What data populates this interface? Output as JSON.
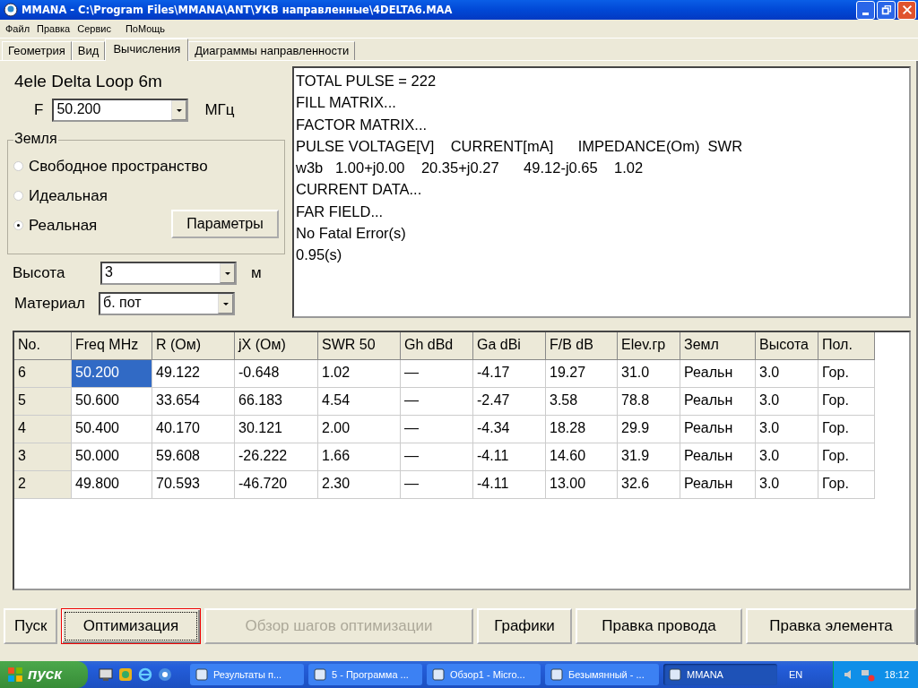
{
  "window": {
    "title": "MMANA - C:\\Program Files\\MMANA\\ANT\\УКВ направленные\\4DELTA6.MAA"
  },
  "menu": [
    "Файл",
    "Правка",
    "Сервис",
    "ПоМощь"
  ],
  "tabs": [
    {
      "label": "Геометрия",
      "selected": false
    },
    {
      "label": "Вид",
      "selected": false
    },
    {
      "label": "Вычисления",
      "selected": true
    },
    {
      "label": "Диаграммы направленности",
      "selected": false
    }
  ],
  "antenna_name": "4ele Delta Loop 6m",
  "frequency": {
    "label": "F",
    "value": "50.200",
    "unit": "МГц"
  },
  "ground": {
    "title": "Земля",
    "options": [
      {
        "label": "Свободное пространство",
        "selected": false
      },
      {
        "label": "Идеальная",
        "selected": false
      },
      {
        "label": "Реальная",
        "selected": true
      }
    ],
    "button": "Параметры"
  },
  "height": {
    "label": "Высота",
    "value": "3",
    "unit": "м"
  },
  "material": {
    "label": "Материал",
    "value": "б. пот"
  },
  "output": [
    "TOTAL PULSE = 222",
    "FILL MATRIX...",
    "FACTOR MATRIX...",
    "PULSE VOLTAGE[V]    CURRENT[mA]      IMPEDANCE(Om)  SWR",
    "w3b   1.00+j0.00    20.35+j0.27      49.12-j0.65    1.02",
    "CURRENT DATA...",
    "FAR FIELD...",
    "No Fatal Error(s)",
    "0.95(s)"
  ],
  "table": {
    "columns": [
      "No.",
      "Freq MHz",
      "R (Ом)",
      "jX (Ом)",
      "SWR 50",
      "Gh dBd",
      "Ga dBi",
      "F/B dB",
      "Elev.гр",
      "Земл",
      "Высота",
      "Пол."
    ],
    "rows": [
      {
        "selected": true,
        "cells": [
          "6",
          "50.200",
          "49.122",
          "-0.648",
          "1.02",
          "—",
          "-4.17",
          "19.27",
          "31.0",
          "Реальн",
          "3.0",
          "Гор."
        ]
      },
      {
        "selected": false,
        "cells": [
          "5",
          "50.600",
          "33.654",
          "66.183",
          "4.54",
          "—",
          "-2.47",
          "3.58",
          "78.8",
          "Реальн",
          "3.0",
          "Гор."
        ]
      },
      {
        "selected": false,
        "cells": [
          "4",
          "50.400",
          "40.170",
          "30.121",
          "2.00",
          "—",
          "-4.34",
          "18.28",
          "29.9",
          "Реальн",
          "3.0",
          "Гор."
        ]
      },
      {
        "selected": false,
        "cells": [
          "3",
          "50.000",
          "59.608",
          "-26.222",
          "1.66",
          "—",
          "-4.11",
          "14.60",
          "31.9",
          "Реальн",
          "3.0",
          "Гор."
        ]
      },
      {
        "selected": false,
        "cells": [
          "2",
          "49.800",
          "70.593",
          "-46.720",
          "2.30",
          "—",
          "-4.11",
          "13.00",
          "32.6",
          "Реальн",
          "3.0",
          "Гор."
        ]
      }
    ]
  },
  "buttons": [
    {
      "label": "Пуск",
      "disabled": false,
      "focused": false
    },
    {
      "label": "Оптимизация",
      "disabled": false,
      "focused": true
    },
    {
      "label": "Обзор шагов оптимизации",
      "disabled": true,
      "focused": false
    },
    {
      "label": "Графики",
      "disabled": false,
      "focused": false
    },
    {
      "label": "Правка провода",
      "disabled": false,
      "focused": false
    },
    {
      "label": "Правка элемента",
      "disabled": false,
      "focused": false
    }
  ],
  "taskbar": {
    "start": "пуск",
    "items": [
      {
        "label": "Результаты п...",
        "active": false
      },
      {
        "label": "5 - Программа ...",
        "active": false
      },
      {
        "label": "Обзор1 - Micro...",
        "active": false
      },
      {
        "label": "Безымянный - ...",
        "active": false
      },
      {
        "label": "MMANA",
        "active": true
      }
    ],
    "language": "EN",
    "clock": "18:12"
  }
}
